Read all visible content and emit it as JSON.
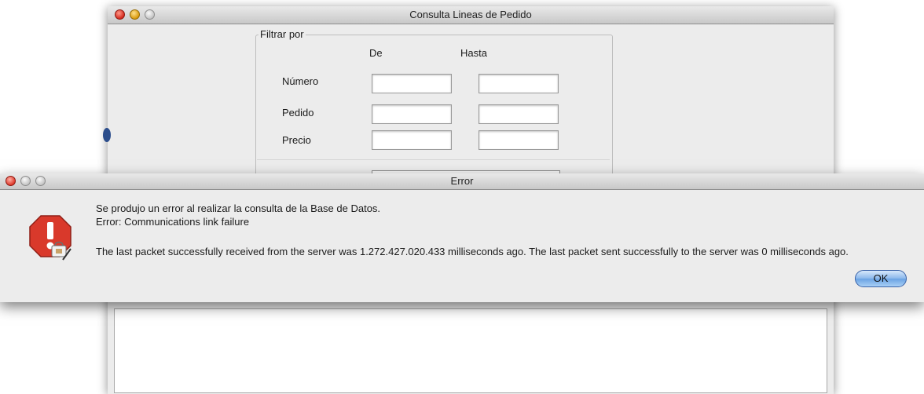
{
  "main_window": {
    "title": "Consulta Lineas de Pedido",
    "filter": {
      "legend": "Filtrar por",
      "col_from": "De",
      "col_to": "Hasta",
      "rows": [
        {
          "label": "Número",
          "from": "",
          "to": ""
        },
        {
          "label": "Pedido",
          "from": "",
          "to": ""
        },
        {
          "label": "Precio",
          "from": "",
          "to": ""
        }
      ]
    }
  },
  "error_dialog": {
    "title": "Error",
    "icon": "stop-warning-icon",
    "line1": "Se produjo un error al realizar la consulta de la Base de Datos.",
    "line2": "Error: Communications link failure",
    "line3": "The last packet successfully received from the server was 1.272.427.020.433 milliseconds ago.  The last packet sent successfully to the server was 0 milliseconds ago.",
    "ok_label": "OK"
  },
  "colors": {
    "close_red": "#d4291d",
    "minimize_yellow": "#d99a0e",
    "ok_blue": "#6aa2e3",
    "stop_icon_red": "#d9392b"
  }
}
